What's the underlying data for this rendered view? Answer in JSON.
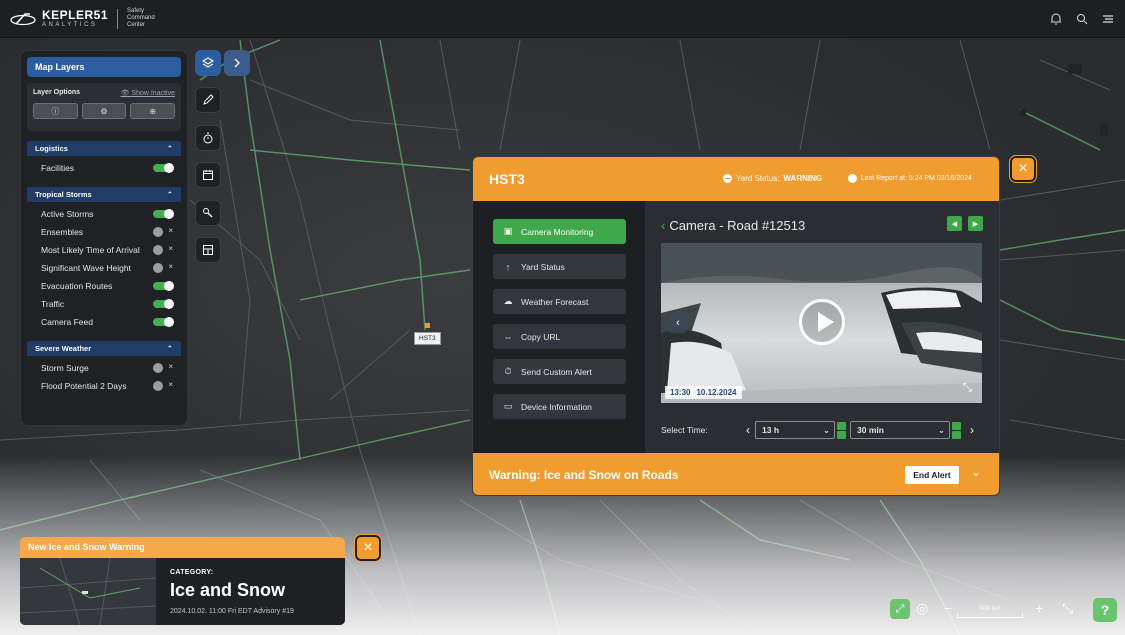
{
  "brand": {
    "name": "KEPLER51",
    "sub": "ANALYTICS",
    "app_line1": "Safety",
    "app_line2": "Command",
    "app_line3": "Center"
  },
  "topbar": {
    "icons": [
      "bell-icon",
      "search-icon",
      "menu-icon"
    ]
  },
  "layers_panel": {
    "title": "Map Layers",
    "options_title": "Layer Options",
    "show_inactive": "Show Inactive",
    "option_buttons": [
      "info-icon",
      "settings-icon",
      "add-icon"
    ],
    "sections": [
      {
        "name": "Logistics",
        "items": [
          {
            "label": "Facilities",
            "on": true
          }
        ]
      },
      {
        "name": "Tropical Storms",
        "items": [
          {
            "label": "Active Storms",
            "on": true
          },
          {
            "label": "Ensembles",
            "on": false
          },
          {
            "label": "Most Likely Time of Arrival",
            "on": false
          },
          {
            "label": "Significant Wave Height",
            "on": false
          },
          {
            "label": "Evacuation Routes",
            "on": true
          },
          {
            "label": "Traffic",
            "on": true
          },
          {
            "label": "Camera Feed",
            "on": true
          }
        ]
      },
      {
        "name": "Severe Weather",
        "items": [
          {
            "label": "Storm Surge",
            "on": false
          },
          {
            "label": "Flood Potential 2 Days",
            "on": false
          }
        ]
      }
    ]
  },
  "tools": [
    "layers-icon",
    "pencil-icon",
    "timer-icon",
    "calendar-icon",
    "tools-icon",
    "layout-icon"
  ],
  "marker": {
    "label": "HST3"
  },
  "modal": {
    "title": "HST3",
    "yard_status_label": "Yard Status:",
    "yard_status_value": "WARNING",
    "last_report": "Last Report at: 5:24 PM 03/16/2024",
    "nav": [
      {
        "label": "Camera Monitoring",
        "icon": "camera-icon",
        "active": true
      },
      {
        "label": "Yard Status",
        "icon": "arrow-up-icon",
        "active": false
      },
      {
        "label": "Weather Forecast",
        "icon": "cloud-sun-icon",
        "active": false
      },
      {
        "label": "Copy URL",
        "icon": "link-icon",
        "active": false
      },
      {
        "label": "Send Custom Alert",
        "icon": "alert-icon",
        "active": false
      },
      {
        "label": "Device Information",
        "icon": "info-icon",
        "active": false
      }
    ],
    "camera_title": "Camera - Road #12513",
    "stamp_time": "13:30",
    "stamp_date": "10.12.2024",
    "select_time_label": "Select Time:",
    "hour_value": "13 h",
    "minute_value": "30 min",
    "footer_warning": "Warning: Ice and Snow on Roads",
    "end_alert": "End Alert"
  },
  "alert_card": {
    "title": "New Ice and Snow Warning",
    "category_label": "CATEGORY:",
    "category_value": "Ice and Snow",
    "advisory": "2024.10.02. 11:00 Fri EDT Advisory #19"
  },
  "map_controls": {
    "scale": "500 km",
    "help": "?"
  },
  "colors": {
    "accent_orange": "#f19c2e",
    "primary_blue": "#2b5da0",
    "active_green": "#3fa84b",
    "panel_bg": "#1f2124"
  }
}
